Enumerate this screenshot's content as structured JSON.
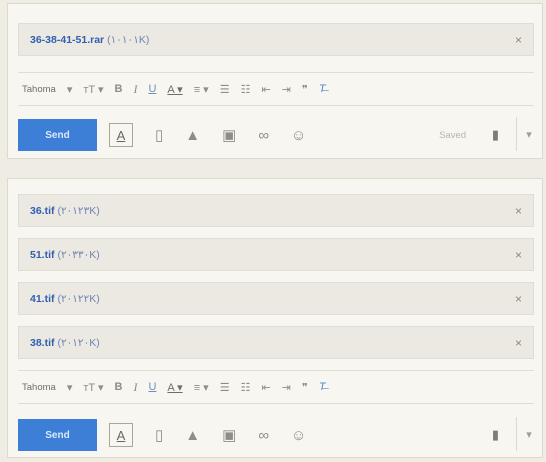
{
  "top": {
    "attachment": {
      "name": "36-38-41-51.rar",
      "size": "(۱۰۱۰۱K)",
      "close": "×"
    },
    "saved": "Saved"
  },
  "bottom": {
    "attachments": [
      {
        "name": "36.tif",
        "size": "(۲۰۱۲۳K)",
        "close": "×"
      },
      {
        "name": "51.tif",
        "size": "(۲۰۳۳۰K)",
        "close": "×"
      },
      {
        "name": "41.tif",
        "size": "(۲۰۱۲۲K)",
        "close": "×"
      },
      {
        "name": "38.tif",
        "size": "(۲۰۱۲۰K)",
        "close": "×"
      }
    ]
  },
  "toolbar": {
    "font": "Tahoma",
    "font_arrow": "▾",
    "size": "тT ▾",
    "bold": "B",
    "italic": "I",
    "underline": "U",
    "text_color": "A ▾",
    "align": "≡ ▾",
    "numbered": "☰",
    "bulleted": "☷",
    "indent_less": "⇤",
    "indent_more": "⇥",
    "quote": "❞",
    "clear": "T̶"
  },
  "compose": {
    "send": "Send",
    "format_icon": "A",
    "attach_icon": "▯",
    "drive_icon": "▲",
    "photo_icon": "▣",
    "link_icon": "∞",
    "emoji_icon": "☺",
    "trash_icon": "▮",
    "more_icon": "▾"
  }
}
